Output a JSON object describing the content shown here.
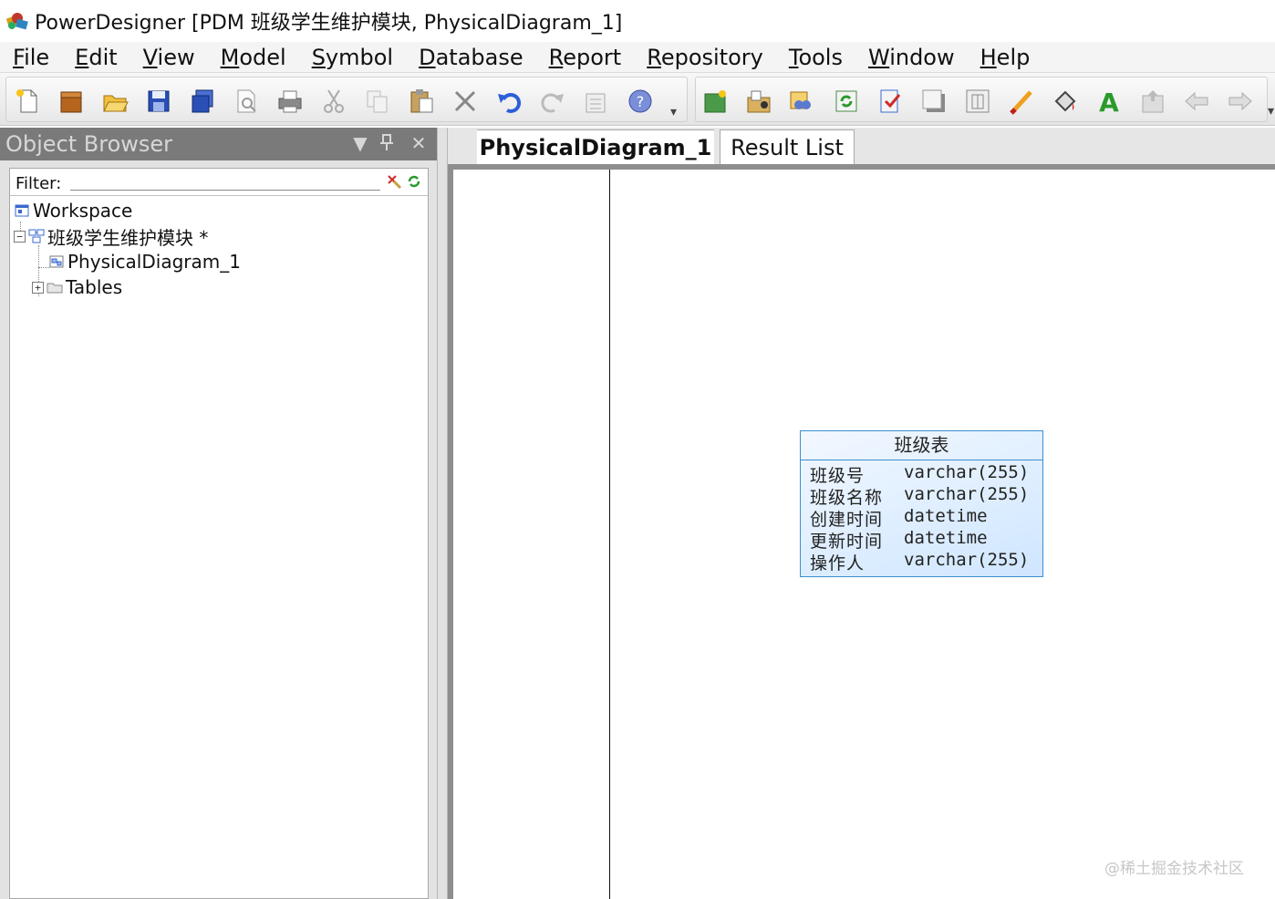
{
  "window": {
    "title": "PowerDesigner [PDM 班级学生维护模块, PhysicalDiagram_1]"
  },
  "menu": [
    {
      "label": "File",
      "mnemonic": "F",
      "rest": "ile"
    },
    {
      "label": "Edit",
      "mnemonic": "E",
      "rest": "dit"
    },
    {
      "label": "View",
      "mnemonic": "V",
      "rest": "iew"
    },
    {
      "label": "Model",
      "mnemonic": "M",
      "rest": "odel"
    },
    {
      "label": "Symbol",
      "mnemonic": "S",
      "rest": "ymbol"
    },
    {
      "label": "Database",
      "mnemonic": "D",
      "rest": "atabase"
    },
    {
      "label": "Report",
      "mnemonic": "R",
      "rest": "eport"
    },
    {
      "label": "Repository",
      "mnemonic": "R",
      "rest": "epository"
    },
    {
      "label": "Tools",
      "mnemonic": "T",
      "rest": "ools"
    },
    {
      "label": "Window",
      "mnemonic": "W",
      "rest": "indow"
    },
    {
      "label": "Help",
      "mnemonic": "H",
      "rest": "elp"
    }
  ],
  "toolbar": {
    "group1": [
      "new-icon",
      "open-project-icon",
      "open-icon",
      "save-icon",
      "save-all-icon",
      "print-preview-icon",
      "print-icon",
      "cut-icon",
      "copy-icon",
      "paste-icon",
      "delete-icon",
      "undo-icon",
      "redo-icon",
      "properties-icon",
      "help-icon"
    ],
    "group2": [
      "new-package-icon",
      "model-browser-icon",
      "find-icon",
      "refresh-icon",
      "check-model-icon",
      "shadow-icon",
      "table-icon",
      "pen-icon",
      "fill-icon",
      "font-icon",
      "export-icon",
      "back-icon",
      "forward-icon"
    ]
  },
  "object_browser": {
    "title": "Object Browser",
    "filter_label": "Filter:",
    "filter_value": "",
    "tree": {
      "workspace": "Workspace",
      "model": "班级学生维护模块 *",
      "diagram": "PhysicalDiagram_1",
      "tables": "Tables"
    }
  },
  "tabs": [
    {
      "label": "PhysicalDiagram_1",
      "active": true
    },
    {
      "label": "Result List",
      "active": false
    }
  ],
  "entity": {
    "title": "班级表",
    "columns": [
      {
        "name": "班级号",
        "type": "varchar(255)"
      },
      {
        "name": "班级名称",
        "type": "varchar(255)"
      },
      {
        "name": "创建时间",
        "type": "datetime"
      },
      {
        "name": "更新时间",
        "type": "datetime"
      },
      {
        "name": "操作人",
        "type": "varchar(255)"
      }
    ]
  },
  "watermark": "@稀土掘金技术社区",
  "colors": {
    "entity_border": "#3a8fd0",
    "entity_fill": "#cfe6ff",
    "panel_header": "#7a7a7a"
  }
}
